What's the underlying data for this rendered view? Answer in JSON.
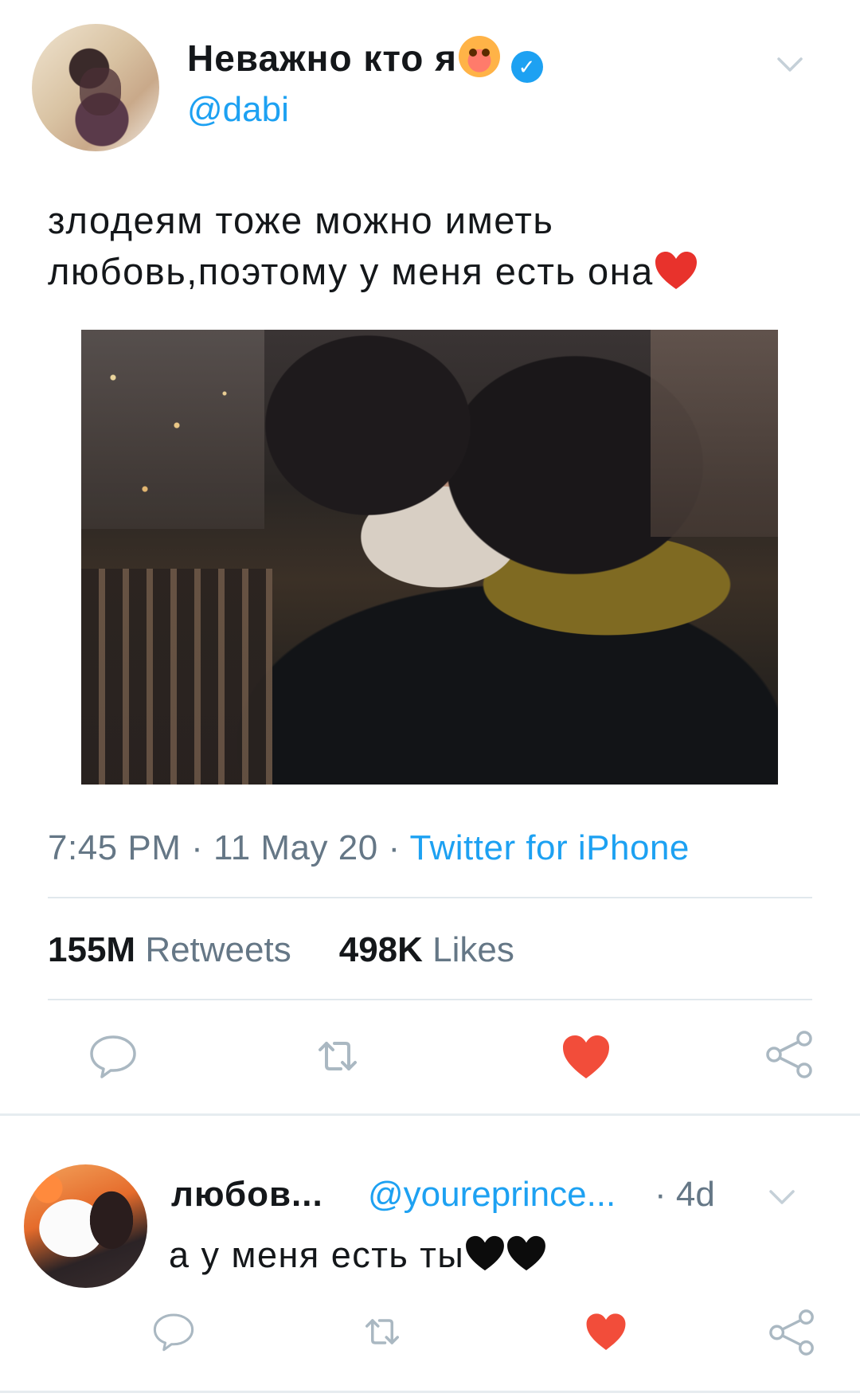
{
  "tweet": {
    "author_name": "Неважно кто я",
    "author_emoji": "hot-face-emoji",
    "verified_icon": "verified-badge-icon",
    "handle": "@dabi",
    "text": "злодеям тоже можно иметь любовь,поэтому у меня есть она",
    "text_trailing_emoji": "red-heart-emoji",
    "time": "7:45 PM",
    "date": "11 May 20",
    "separator": "·",
    "source": "Twitter for iPhone",
    "retweets_count": "155M",
    "retweets_label": "Retweets",
    "likes_count": "498K",
    "likes_label": "Likes",
    "photo": "couple-kissing-night-photo"
  },
  "reply": {
    "author_name": "любов...",
    "handle": "@youreprince...",
    "separator": "·",
    "time": "4d",
    "text": "а у меня есть ты",
    "trailing_emojis": [
      "black-heart-emoji",
      "black-heart-emoji"
    ]
  },
  "colors": {
    "accent": "#1da1f2",
    "like": "#e0245e",
    "muted": "#657786",
    "icon": "#aab8c2",
    "heart_red": "#f24d3a"
  }
}
